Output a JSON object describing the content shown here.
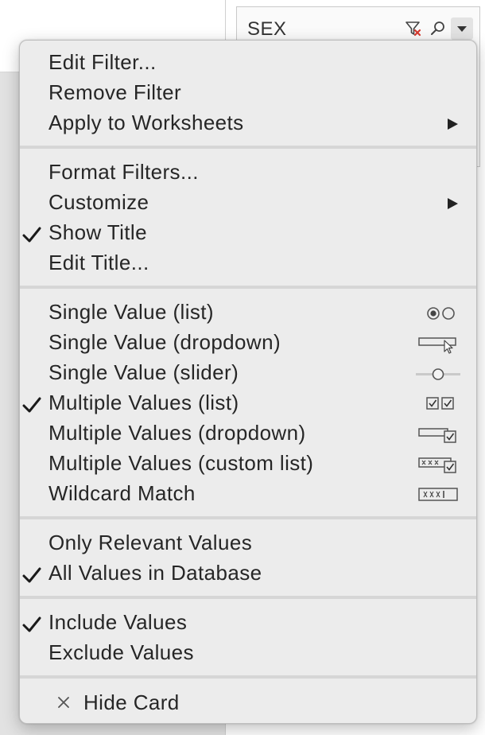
{
  "filter_card": {
    "title": "SEX",
    "icons": [
      "clear-filter-icon",
      "search-icon",
      "dropdown-arrow-icon"
    ]
  },
  "menu": {
    "group1": [
      {
        "label": "Edit Filter...",
        "checked": false,
        "submenu": false
      },
      {
        "label": "Remove Filter",
        "checked": false,
        "submenu": false
      },
      {
        "label": "Apply to Worksheets",
        "checked": false,
        "submenu": true
      }
    ],
    "group2": [
      {
        "label": "Format Filters...",
        "checked": false,
        "submenu": false
      },
      {
        "label": "Customize",
        "checked": false,
        "submenu": true
      },
      {
        "label": "Show Title",
        "checked": true,
        "submenu": false
      },
      {
        "label": "Edit Title...",
        "checked": false,
        "submenu": false
      }
    ],
    "group3": [
      {
        "label": "Single Value (list)",
        "checked": false,
        "icon": "radio-list-icon"
      },
      {
        "label": "Single Value (dropdown)",
        "checked": false,
        "icon": "dropdown-single-icon"
      },
      {
        "label": "Single Value (slider)",
        "checked": false,
        "icon": "slider-icon"
      },
      {
        "label": "Multiple Values (list)",
        "checked": true,
        "icon": "checkbox-list-icon"
      },
      {
        "label": "Multiple Values (dropdown)",
        "checked": false,
        "icon": "dropdown-multi-icon"
      },
      {
        "label": "Multiple Values (custom list)",
        "checked": false,
        "icon": "custom-list-icon"
      },
      {
        "label": "Wildcard Match",
        "checked": false,
        "icon": "wildcard-icon"
      }
    ],
    "group4": [
      {
        "label": "Only Relevant Values",
        "checked": false
      },
      {
        "label": "All Values in Database",
        "checked": true
      }
    ],
    "group5": [
      {
        "label": "Include Values",
        "checked": true
      },
      {
        "label": "Exclude Values",
        "checked": false
      }
    ],
    "hide_card": {
      "label": "Hide Card",
      "icon": "close-icon"
    }
  }
}
